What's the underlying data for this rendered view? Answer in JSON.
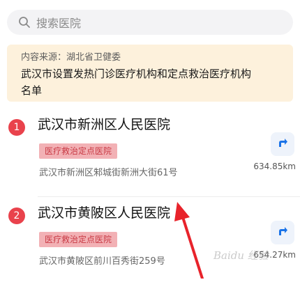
{
  "search": {
    "placeholder": "搜索医院",
    "icon": "search-icon"
  },
  "notice": {
    "source": "内容来源：湖北省卫健委",
    "title_line1": "武汉市设置发热门诊医疗机构和定点救治医疗机构",
    "title_line2": "名单"
  },
  "hospitals": [
    {
      "rank": "1",
      "name": "武汉市新洲区人民医院",
      "tag": "医疗救治定点医院",
      "address": "武汉市新洲区邾城街新洲大街61号",
      "distance": "634.85km"
    },
    {
      "rank": "2",
      "name": "武汉市黄陂区人民医院",
      "tag": "医疗救治定点医院",
      "address": "武汉市黄陂区前川百秀街259号",
      "distance": "654.27km"
    }
  ],
  "colors": {
    "badge": "#e9424c",
    "tag_bg": "#f2b1b5",
    "tag_text": "#c93a45",
    "notice_bg": "#fdf1dc",
    "nav_arrow": "#1a73e8",
    "annotation": "#e8232b"
  },
  "watermark": "Baidu 经验"
}
